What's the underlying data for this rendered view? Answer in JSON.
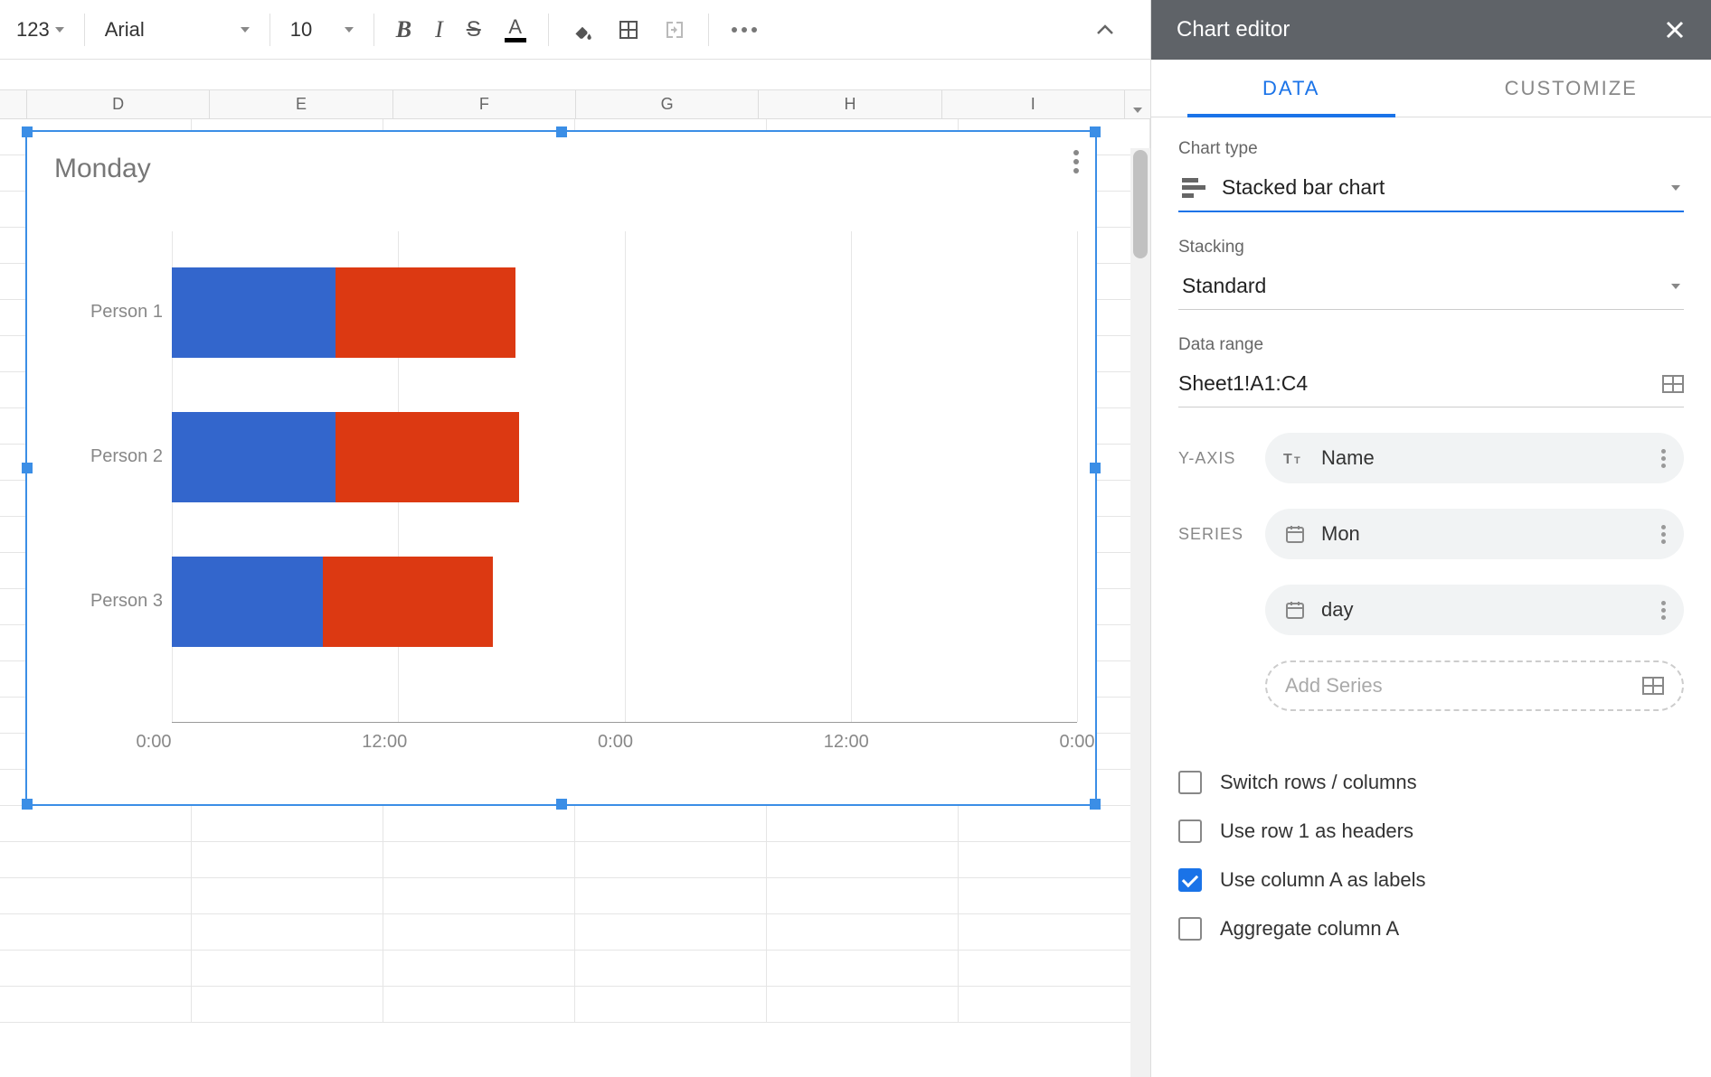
{
  "toolbar": {
    "format_123": "123",
    "font": "Arial",
    "size": "10"
  },
  "columns": [
    "D",
    "E",
    "F",
    "G",
    "H",
    "I"
  ],
  "chart_data": {
    "type": "bar",
    "orientation": "horizontal",
    "stacking": "standard",
    "title": "Monday",
    "categories": [
      "Person 1",
      "Person 2",
      "Person 3"
    ],
    "series": [
      {
        "name": "Mon",
        "values": [
          8.7,
          8.7,
          8.0
        ],
        "color": "#3366cc"
      },
      {
        "name": "day",
        "values": [
          9.5,
          9.7,
          9.0
        ],
        "color": "#dc3912"
      }
    ],
    "x_ticks": [
      "0:00",
      "12:00",
      "0:00",
      "12:00",
      "0:00"
    ],
    "xlim": [
      0,
      48
    ],
    "xlabel": "",
    "ylabel": ""
  },
  "editor": {
    "title": "Chart editor",
    "tabs": {
      "data": "DATA",
      "customize": "CUSTOMIZE"
    },
    "chart_type_label": "Chart type",
    "chart_type_value": "Stacked bar chart",
    "stacking_label": "Stacking",
    "stacking_value": "Standard",
    "data_range_label": "Data range",
    "data_range_value": "Sheet1!A1:C4",
    "yaxis_label": "Y-AXIS",
    "yaxis_value": "Name",
    "series_label": "SERIES",
    "series": [
      "Mon",
      "day"
    ],
    "add_series": "Add Series",
    "checks": {
      "switch": {
        "label": "Switch rows / columns",
        "checked": false
      },
      "row1": {
        "label": "Use row 1 as headers",
        "checked": false
      },
      "colA": {
        "label": "Use column A as labels",
        "checked": true
      },
      "agg": {
        "label": "Aggregate column A",
        "checked": false
      }
    }
  }
}
